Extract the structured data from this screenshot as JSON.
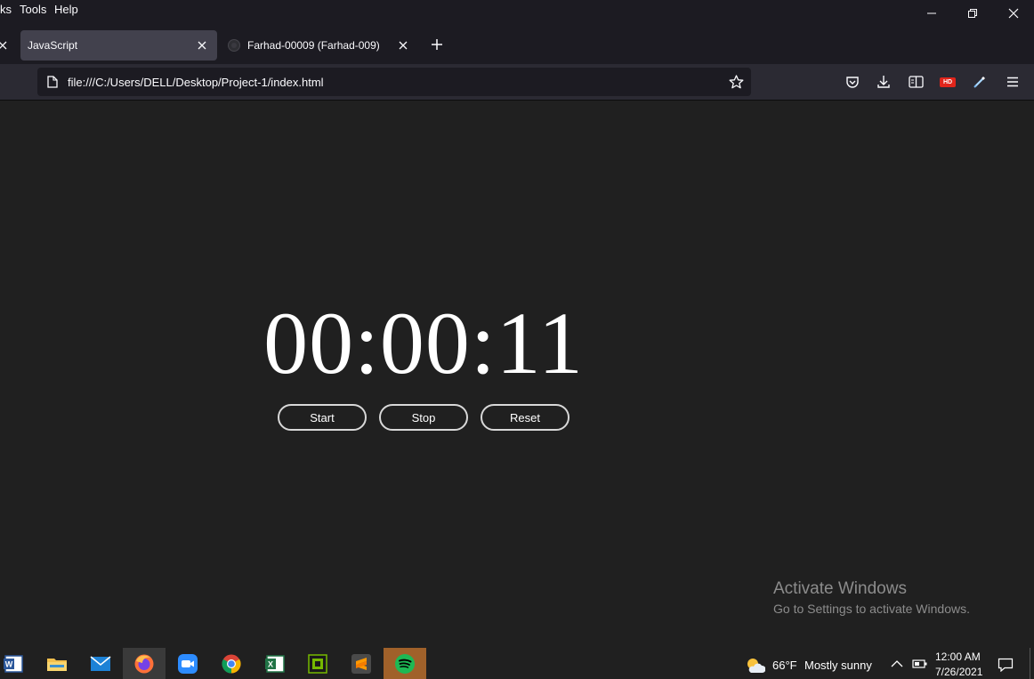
{
  "menubar": {
    "items": [
      "ks",
      "Tools",
      "Help"
    ]
  },
  "tabs": [
    {
      "label": "JavaScript",
      "active": true
    },
    {
      "label": "Farhad-00009 (Farhad-009)",
      "active": false
    }
  ],
  "navbar": {
    "url": "file:///C:/Users/DELL/Desktop/Project-1/index.html",
    "hd_badge": "HD"
  },
  "stopwatch": {
    "display": "00:00:11",
    "buttons": {
      "start": "Start",
      "stop": "Stop",
      "reset": "Reset"
    }
  },
  "watermark": {
    "title": "Activate Windows",
    "subtitle": "Go to Settings to activate Windows."
  },
  "taskbar": {
    "apps": [
      "word-icon",
      "file-explorer-icon",
      "mail-icon",
      "firefox-icon",
      "zoom-icon",
      "chrome-icon",
      "excel-icon",
      "nvidia-icon",
      "sublime-text-icon",
      "spotify-icon"
    ],
    "weather": {
      "temp": "66°F",
      "condition": "Mostly sunny"
    },
    "time": "12:00 AM",
    "date": "7/26/2021"
  },
  "colors": {
    "page_background": "#202020",
    "chrome_dark": "#1c1b22",
    "navbar": "#2b2a33",
    "active_tab": "#42414d",
    "timer_text": "#ffffff",
    "button_border": "#d8d8d8"
  }
}
